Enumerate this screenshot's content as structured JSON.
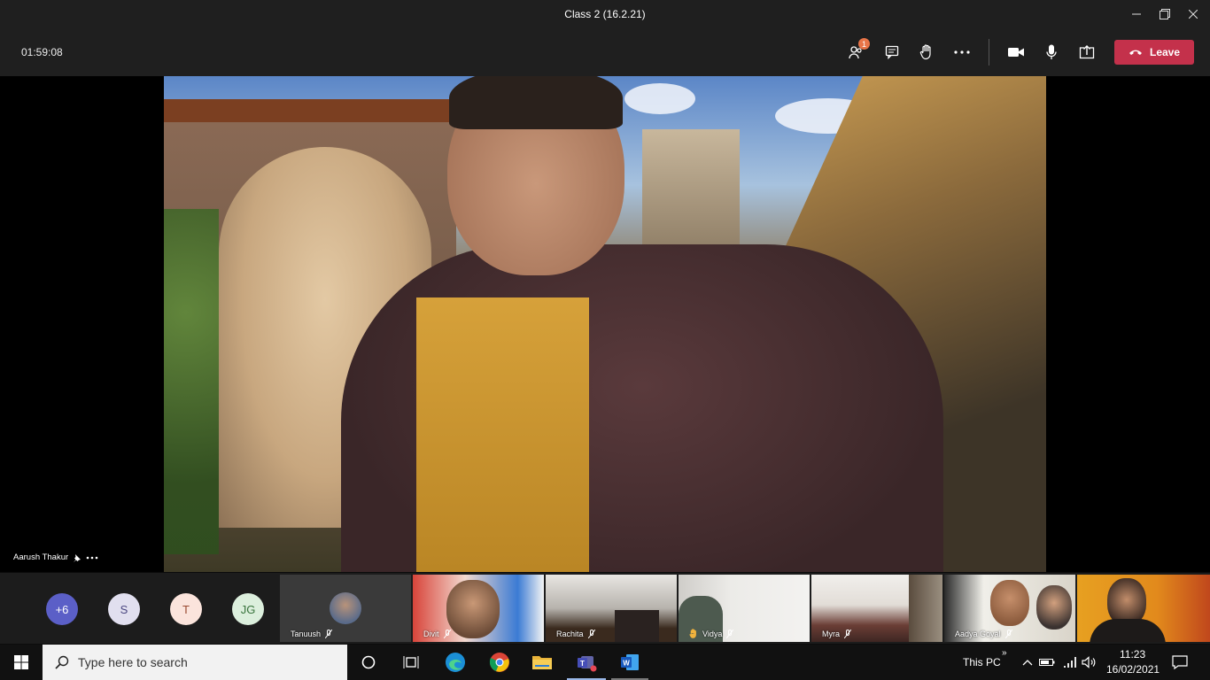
{
  "window": {
    "title": "Class 2 (16.2.21)",
    "controls": [
      "minimize-icon",
      "restore-icon",
      "close-icon"
    ]
  },
  "toolbar": {
    "timer": "01:59:08",
    "participants_badge": "1",
    "leave_label": "Leave",
    "buttons": [
      "participants-icon",
      "chat-icon",
      "raise-hand-icon",
      "more-options-icon",
      "camera-icon",
      "microphone-icon",
      "share-screen-icon"
    ]
  },
  "stage": {
    "speaker_name": "Aarush Thakur"
  },
  "gallery": {
    "overflow_count": "+6",
    "avatars": [
      {
        "initials": "S",
        "bg": "#e1dfef",
        "fg": "#4a4680"
      },
      {
        "initials": "T",
        "bg": "#fbe4dc",
        "fg": "#9a4a32"
      },
      {
        "initials": "JG",
        "bg": "#dcefdd",
        "fg": "#38733c"
      }
    ],
    "tiles": [
      {
        "name": "Tanuush"
      },
      {
        "name": "Divit"
      },
      {
        "name": "Rachita"
      },
      {
        "name": "Vidya"
      },
      {
        "name": "Myra"
      },
      {
        "name": "Aadya Goyal"
      },
      {
        "name": ""
      }
    ]
  },
  "taskbar": {
    "search_placeholder": "Type here to search",
    "this_pc_label": "This PC",
    "time": "11:23",
    "date": "16/02/2021"
  },
  "colors": {
    "leave": "#c4314b",
    "badge": "#e97548",
    "overflow_avatar": "#5b5fc7"
  }
}
